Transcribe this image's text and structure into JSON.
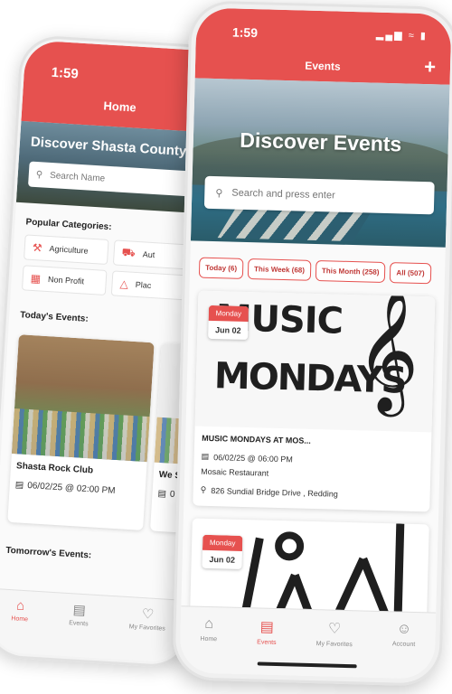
{
  "back_phone": {
    "time": "1:59",
    "title": "Home",
    "hero_title": "Discover Shasta County",
    "search_placeholder": "Search Name",
    "popular_label": "Popular Categories:",
    "categories": [
      {
        "label": "Agriculture",
        "icon": "tractor-icon"
      },
      {
        "label": "Aut",
        "icon": "car-icon"
      },
      {
        "label": "Non Profit",
        "icon": "building-icon"
      },
      {
        "label": "Plac",
        "icon": "church-icon"
      }
    ],
    "today_label": "Today's Events:",
    "today_events": [
      {
        "title": "Shasta Rock Club",
        "date": "06/02/25 @ 02:00 PM"
      },
      {
        "title": "We Si",
        "date": "0"
      }
    ],
    "tomorrow_label": "Tomorrow's Events:",
    "tabs": [
      {
        "label": "Home",
        "icon": "home-icon"
      },
      {
        "label": "Events",
        "icon": "calendar-icon"
      },
      {
        "label": "My Favorites",
        "icon": "heart-icon"
      }
    ]
  },
  "front_phone": {
    "time": "1:59",
    "title": "Events",
    "add_symbol": "+",
    "hero_title": "Discover Events",
    "search_placeholder": "Search and press enter",
    "filters": [
      "Today (6)",
      "This Week (68)",
      "This Month (258)",
      "All (507)"
    ],
    "events": [
      {
        "badge_day": "Monday",
        "badge_date": "Jun 02",
        "image_line1": "MUSIC",
        "image_line2": "MONDAYS",
        "title": "MUSIC MONDAYS AT MOS...",
        "datetime": "06/02/25 @ 06:00 PM",
        "venue": "Mosaic Restaurant",
        "address": "826 Sundial Bridge Drive , Redding"
      },
      {
        "badge_day": "Monday",
        "badge_date": "Jun 02"
      }
    ],
    "tabs": [
      {
        "label": "Home",
        "icon": "home-icon"
      },
      {
        "label": "Events",
        "icon": "calendar-icon"
      },
      {
        "label": "My Favorites",
        "icon": "heart-icon"
      },
      {
        "label": "Account",
        "icon": "user-icon"
      }
    ]
  },
  "colors": {
    "accent": "#e6514f",
    "accent_dark": "#c03836"
  }
}
